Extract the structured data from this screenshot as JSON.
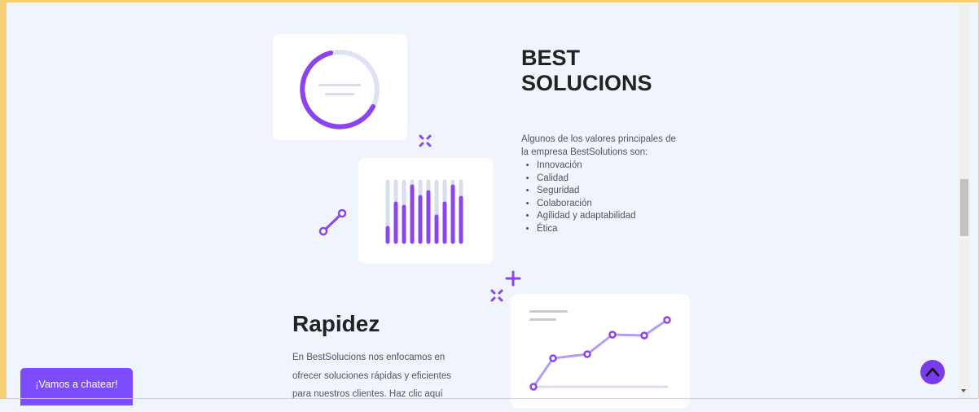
{
  "section": {
    "title_line1": "BEST",
    "title_line2": "SOLUCIONS",
    "intro": "Algunos de los valores principales de la empresa BestSolutions son:",
    "values": [
      "Innovación",
      "Calidad",
      "Seguridad",
      "Colaboración",
      "Agilidad y adaptabilidad",
      "Ética"
    ]
  },
  "rapidez": {
    "heading": "Rapidez",
    "paragraph": "En BestSolucions nos enfocamos en ofrecer soluciones rápidas y eficientes para nuestros clientes. Haz clic aquí"
  },
  "chat": {
    "label": "¡Vamos a chatear!"
  },
  "back_to_top": {
    "icon": "chevron-up-icon"
  },
  "colors": {
    "accent": "#7c4dff",
    "accent_light": "#b69cf5",
    "muted": "#dbe0ef",
    "background": "#f0f4fc"
  }
}
